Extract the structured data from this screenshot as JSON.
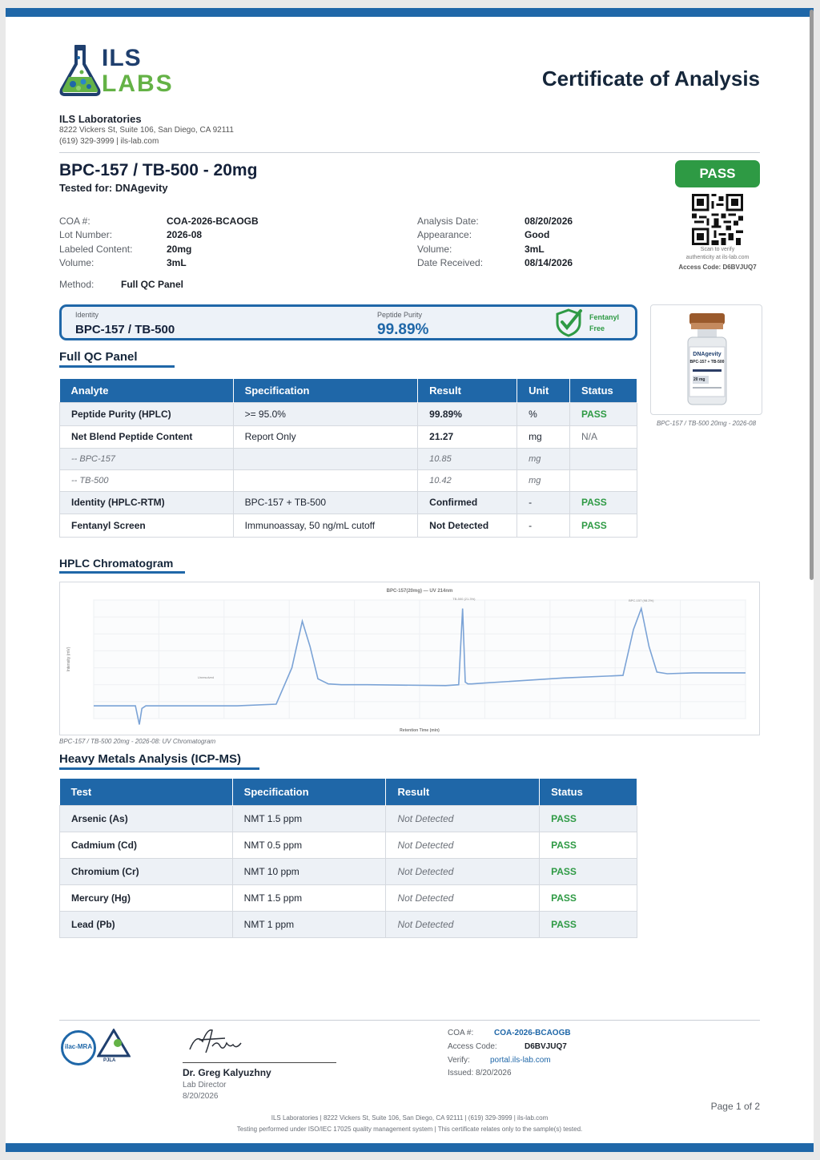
{
  "header": {
    "logo_line1": "ILS",
    "logo_line2": "LABS",
    "title": "Certificate of Analysis",
    "lab_name": "ILS Laboratories",
    "lab_address": "8222 Vickers St, Suite 106, San Diego, CA 92111",
    "lab_contact": "(619) 329-3999  |  ils-lab.com"
  },
  "product": {
    "name": "BPC-157 / TB-500 - 20mg",
    "tested_for": "Tested for: DNAgevity",
    "status": "PASS"
  },
  "qr": {
    "scan_text_1": "Scan to verify",
    "scan_text_2": "authenticity at ils-lab.com",
    "access": "Access Code: D6BVJUQ7"
  },
  "meta_left": [
    {
      "label": "COA #:",
      "value": "COA-2026-BCAOGB"
    },
    {
      "label": "Lot Number:",
      "value": "2026-08"
    },
    {
      "label": "Labeled Content:",
      "value": "20mg"
    },
    {
      "label": "Volume:",
      "value": "3mL"
    }
  ],
  "meta_right": [
    {
      "label": "Analysis Date:",
      "value": "08/20/2026"
    },
    {
      "label": "Appearance:",
      "value": "Good"
    },
    {
      "label": "Volume:",
      "value": "3mL"
    },
    {
      "label": "Date Received:",
      "value": "08/14/2026"
    }
  ],
  "method": {
    "label": "Method:",
    "value": "Full QC Panel"
  },
  "summary": {
    "identity_label": "Identity",
    "identity_value": "BPC-157 / TB-500",
    "purity_label": "Peptide Purity",
    "purity_value": "99.89%",
    "fentanyl_line1": "Fentanyl",
    "fentanyl_line2": "Free"
  },
  "vial": {
    "brand": "DNAgevity",
    "label": "BPC-157 + TB-500",
    "dose": "20 mg",
    "caption": "BPC-157 / TB-500 20mg - 2026-08"
  },
  "qc_panel": {
    "title": "Full QC Panel",
    "headers": [
      "Analyte",
      "Specification",
      "Result",
      "Unit",
      "Status"
    ],
    "rows": [
      {
        "analyte": "Peptide Purity (HPLC)",
        "spec": ">= 95.0%",
        "result": "99.89%",
        "unit": "%",
        "status": "PASS"
      },
      {
        "analyte": "Net Blend Peptide Content",
        "spec": "Report Only",
        "result": "21.27",
        "unit": "mg",
        "status": "N/A"
      },
      {
        "analyte": "-- BPC-157",
        "spec": "",
        "result": "10.85",
        "unit": "mg",
        "status": ""
      },
      {
        "analyte": "-- TB-500",
        "spec": "",
        "result": "10.42",
        "unit": "mg",
        "status": ""
      },
      {
        "analyte": "Identity (HPLC-RTM)",
        "spec": "BPC-157 + TB-500",
        "result": "Confirmed",
        "unit": "-",
        "status": "PASS"
      },
      {
        "analyte": "Fentanyl Screen",
        "spec": "Immunoassay, 50 ng/mL cutoff",
        "result": "Not Detected",
        "unit": "-",
        "status": "PASS"
      }
    ]
  },
  "hplc": {
    "title": "HPLC Chromatogram",
    "caption": "BPC-157 / TB-500 20mg - 2026-08: UV Chromatogram"
  },
  "chart_data": {
    "type": "line",
    "title": "BPC-157(20mg) — UV 214nm",
    "xlabel": "Retention Time (min)",
    "ylabel": "Intensity (mV)",
    "xlim": [
      0,
      25
    ],
    "ylim": [
      -150,
      1250
    ],
    "grid": true,
    "annotations": [
      "Unresolved",
      "TB-500 (21.3%)",
      "BPC-157 (98.2%)"
    ],
    "series": [
      {
        "x": [
          0,
          1.6,
          1.75,
          1.85,
          2.0,
          5.5,
          7.0,
          7.6,
          8.0,
          8.3,
          8.6,
          9.0,
          9.5,
          10.5,
          13.5,
          14.0,
          14.15,
          14.25,
          14.35,
          14.5,
          15.0,
          18.0,
          20.3,
          20.7,
          21.0,
          21.3,
          21.6,
          22.0,
          23.0,
          25.0
        ],
        "y": [
          0,
          0,
          -220,
          -30,
          0,
          0,
          20,
          450,
          1000,
          700,
          320,
          260,
          250,
          250,
          240,
          250,
          1150,
          280,
          260,
          260,
          270,
          330,
          360,
          900,
          1150,
          700,
          400,
          380,
          390,
          390
        ]
      }
    ]
  },
  "heavy_metals": {
    "title": "Heavy Metals Analysis (ICP-MS)",
    "headers": [
      "Test",
      "Specification",
      "Result",
      "Status"
    ],
    "rows": [
      {
        "test": "Arsenic (As)",
        "spec": "NMT 1.5 ppm",
        "result": "Not Detected",
        "status": "PASS"
      },
      {
        "test": "Cadmium (Cd)",
        "spec": "NMT 0.5 ppm",
        "result": "Not Detected",
        "status": "PASS"
      },
      {
        "test": "Chromium (Cr)",
        "spec": "NMT 10 ppm",
        "result": "Not Detected",
        "status": "PASS"
      },
      {
        "test": "Mercury (Hg)",
        "spec": "NMT 1.5 ppm",
        "result": "Not Detected",
        "status": "PASS"
      },
      {
        "test": "Lead (Pb)",
        "spec": "NMT 1 ppm",
        "result": "Not Detected",
        "status": "PASS"
      }
    ]
  },
  "footer": {
    "accred1": "ilac-MRA",
    "accred2": "PJLA",
    "signer": "Dr. Greg Kalyuzhny",
    "signer_title": "Lab Director",
    "signer_date": "8/20/2026",
    "coa_label": "COA #:",
    "coa_value": "COA-2026-BCAOGB",
    "access_label": "Access Code:",
    "access_value": "D6BVJUQ7",
    "verify_label": "Verify:",
    "verify_value": "portal.ils-lab.com",
    "issued": "Issued: 8/20/2026",
    "page": "Page 1 of 2",
    "line1": "ILS Laboratories  |  8222 Vickers St, Suite 106, San Diego, CA 92111  |  (619) 329-3999  |  ils-lab.com",
    "line2": "Testing performed under ISO/IEC 17025 quality management system  |  This certificate relates only to the sample(s) tested."
  },
  "colors": {
    "brand_blue": "#1f67a8",
    "pass_green": "#2e9a44",
    "logo_green": "#64b246"
  }
}
